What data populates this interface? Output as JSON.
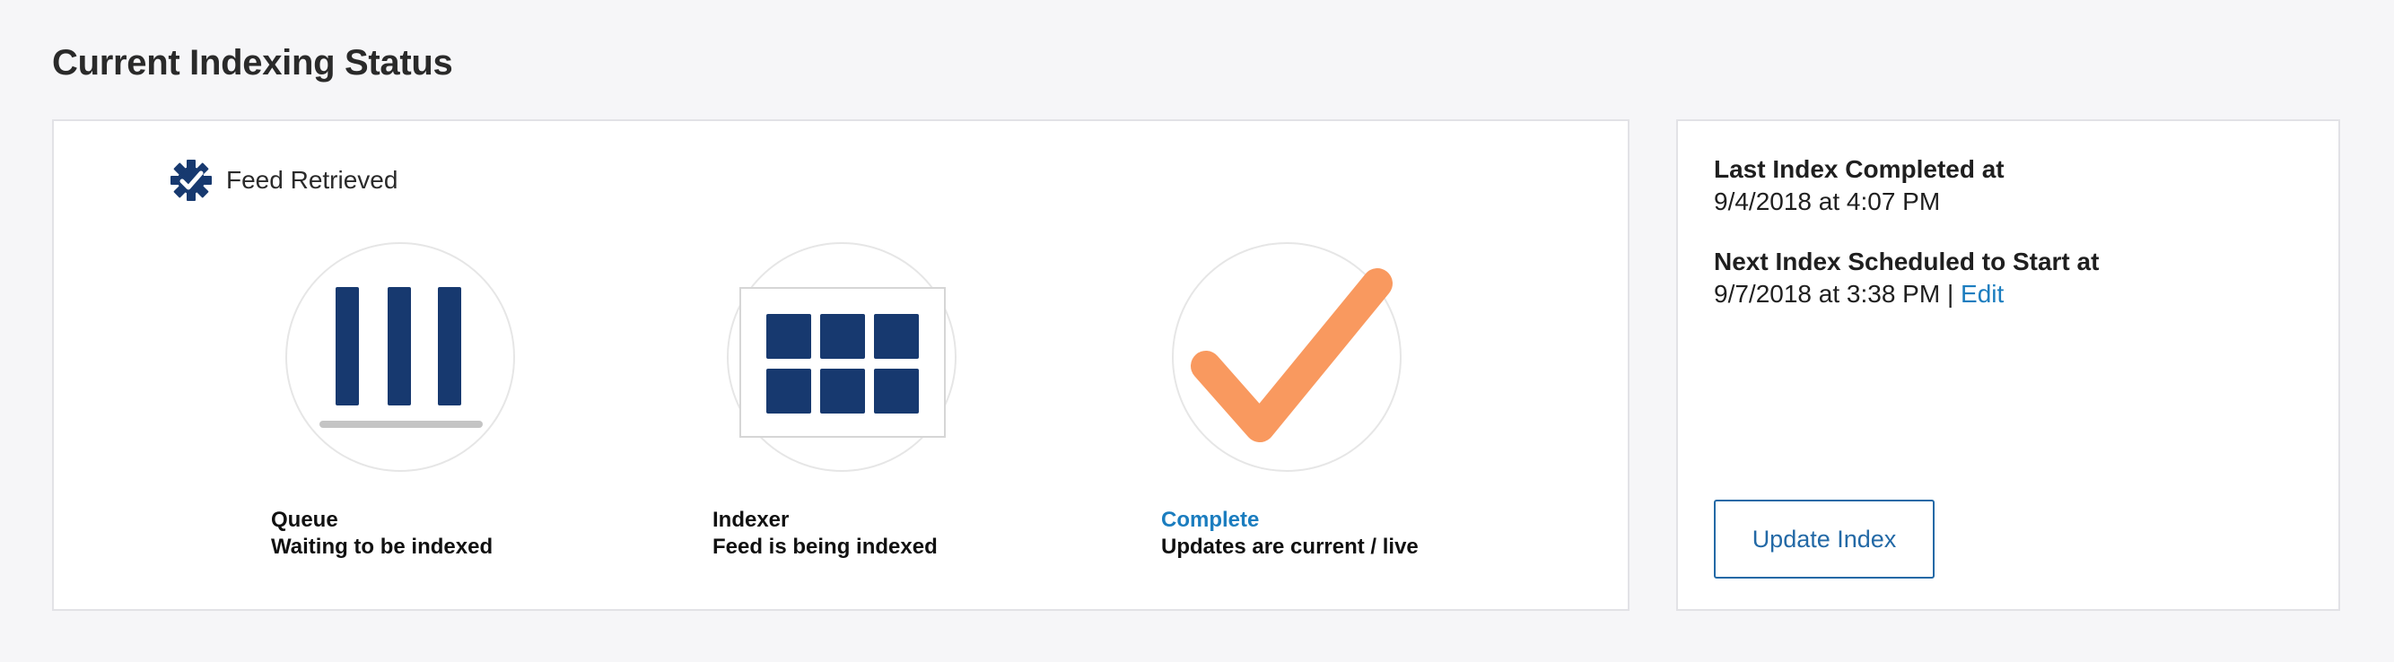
{
  "page": {
    "title": "Current Indexing Status"
  },
  "status_card": {
    "feed_status": {
      "label": "Feed Retrieved",
      "icon": "gear-check-icon"
    },
    "stages": [
      {
        "title": "Queue",
        "description": "Waiting to be indexed",
        "icon": "queue-bars-icon",
        "active": false
      },
      {
        "title": "Indexer",
        "description": "Feed is being indexed",
        "icon": "index-grid-icon",
        "active": false
      },
      {
        "title": "Complete",
        "description": "Updates are current / live",
        "icon": "checkmark-icon",
        "active": true
      }
    ]
  },
  "schedule": {
    "last_label": "Last Index Completed at",
    "last_value": "9/4/2018 at 4:07 PM",
    "next_label": "Next Index Scheduled to Start at",
    "next_value": "9/7/2018 at 3:38 PM",
    "separator": " | ",
    "edit_label": "Edit"
  },
  "actions": {
    "update_label": "Update Index"
  },
  "colors": {
    "navy": "#17396f",
    "link": "#1b7dbf",
    "check": "#f9995f",
    "button_border": "#2369a6"
  }
}
